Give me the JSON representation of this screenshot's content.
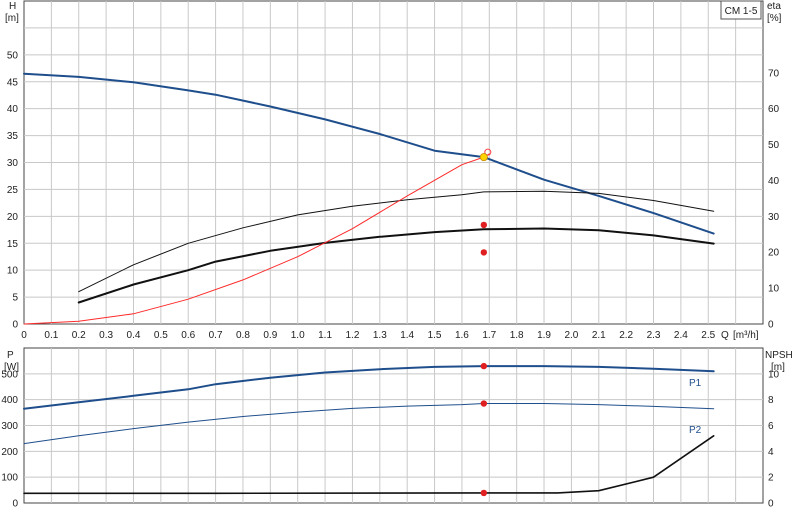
{
  "chart_data": [
    {
      "type": "line",
      "title": "CM 1-5",
      "ylabel": "H",
      "yunit": "[m]",
      "y2label": "eta",
      "y2unit": "[%]",
      "xlabel": "Q",
      "xunit": "[m³/h]",
      "xlim": [
        0,
        2.7
      ],
      "ylim": [
        0,
        60
      ],
      "y2lim": [
        0,
        90
      ],
      "xticks": [
        "0",
        "0.1",
        "0.2",
        "0.3",
        "0.4",
        "0.5",
        "0.6",
        "0.7",
        "0.8",
        "0.9",
        "1.0",
        "1.1",
        "1.2",
        "1.3",
        "1.4",
        "1.5",
        "1.6",
        "1.7",
        "1.8",
        "1.9",
        "2.0",
        "2.1",
        "2.2",
        "2.3",
        "2.4",
        "2.5"
      ],
      "yticks": [
        "0",
        "5",
        "10",
        "15",
        "20",
        "25",
        "30",
        "35",
        "40",
        "45",
        "50"
      ],
      "y2ticks": [
        "0",
        "10",
        "20",
        "30",
        "40",
        "50",
        "60",
        "70"
      ],
      "grid": true,
      "duty_point": {
        "q": 1.68,
        "h": 31.0
      },
      "series": [
        {
          "key": "head",
          "color": "#1f4e8c",
          "width": 2,
          "x": [
            0,
            0.2,
            0.4,
            0.6,
            0.7,
            0.9,
            1.1,
            1.3,
            1.5,
            1.68,
            1.9,
            2.1,
            2.3,
            2.52
          ],
          "y": [
            46.5,
            45.9,
            44.9,
            43.4,
            42.6,
            40.4,
            38.0,
            35.3,
            32.2,
            31.0,
            26.8,
            23.8,
            20.6,
            16.8
          ]
        },
        {
          "key": "eta_total",
          "color": "#111111",
          "width": 2,
          "axis": "y2",
          "x": [
            0.2,
            0.4,
            0.6,
            0.7,
            0.9,
            1.1,
            1.3,
            1.5,
            1.68,
            1.9,
            2.1,
            2.3,
            2.52
          ],
          "y": [
            6.0,
            11.0,
            15.0,
            17.4,
            20.4,
            22.6,
            24.3,
            25.6,
            26.4,
            26.6,
            26.1,
            24.7,
            22.4
          ]
        },
        {
          "key": "eta_pump",
          "color": "#111111",
          "width": 1,
          "axis": "y2",
          "x": [
            0.2,
            0.4,
            0.6,
            0.8,
            1.0,
            1.2,
            1.4,
            1.6,
            1.68,
            1.9,
            2.1,
            2.3,
            2.52
          ],
          "y": [
            9.0,
            16.5,
            22.5,
            26.8,
            30.4,
            32.8,
            34.6,
            36.0,
            36.8,
            37.0,
            36.4,
            34.4,
            31.4
          ]
        },
        {
          "key": "system_curve",
          "color": "#ff2a2a",
          "width": 1,
          "x": [
            0,
            0.2,
            0.4,
            0.6,
            0.8,
            1.0,
            1.2,
            1.4,
            1.6,
            1.68,
            1.7
          ],
          "y": [
            0,
            0.5,
            1.9,
            4.6,
            8.2,
            12.5,
            17.7,
            23.8,
            29.6,
            31.0,
            31.6
          ]
        }
      ],
      "markers": [
        {
          "x": 1.68,
          "y": 18.4,
          "color": "#e02020"
        },
        {
          "x": 1.68,
          "y": 13.3,
          "color": "#e02020"
        }
      ]
    },
    {
      "type": "line",
      "ylabel": "P",
      "yunit": "[W]",
      "y2label": "NPSH",
      "y2unit": "[m]",
      "xlim": [
        0,
        2.7
      ],
      "ylim": [
        0,
        600
      ],
      "y2lim": [
        0,
        12
      ],
      "yticks": [
        "0",
        "100",
        "200",
        "300",
        "400",
        "500"
      ],
      "y2ticks": [
        "0",
        "2",
        "4",
        "6",
        "8",
        "10"
      ],
      "grid": true,
      "series": [
        {
          "key": "p1",
          "name": "P1",
          "color": "#1f4e8c",
          "width": 2,
          "x": [
            0,
            0.2,
            0.4,
            0.6,
            0.7,
            0.9,
            1.1,
            1.3,
            1.5,
            1.68,
            1.9,
            2.1,
            2.3,
            2.52
          ],
          "y": [
            365,
            390,
            415,
            440,
            460,
            485,
            505,
            518,
            527,
            530,
            530,
            527,
            520,
            510
          ]
        },
        {
          "key": "p2",
          "name": "P2",
          "color": "#1f4e8c",
          "width": 1,
          "x": [
            0,
            0.2,
            0.4,
            0.6,
            0.8,
            1.0,
            1.2,
            1.4,
            1.6,
            1.68,
            1.9,
            2.1,
            2.3,
            2.52
          ],
          "y": [
            230,
            260,
            288,
            313,
            335,
            352,
            366,
            375,
            381,
            385,
            385,
            381,
            374,
            365
          ]
        },
        {
          "key": "npsh",
          "color": "#111111",
          "width": 1.6,
          "axis": "y2",
          "x": [
            0,
            0.7,
            1.68,
            1.95,
            2.1,
            2.3,
            2.52
          ],
          "y": [
            0.75,
            0.75,
            0.78,
            0.78,
            0.95,
            2.0,
            5.2
          ]
        }
      ],
      "markers": [
        {
          "x": 1.68,
          "y": 530,
          "color": "#e02020"
        },
        {
          "x": 1.68,
          "y": 385,
          "color": "#e02020"
        },
        {
          "x": 1.68,
          "y2": 0.78,
          "color": "#e02020"
        }
      ]
    }
  ]
}
